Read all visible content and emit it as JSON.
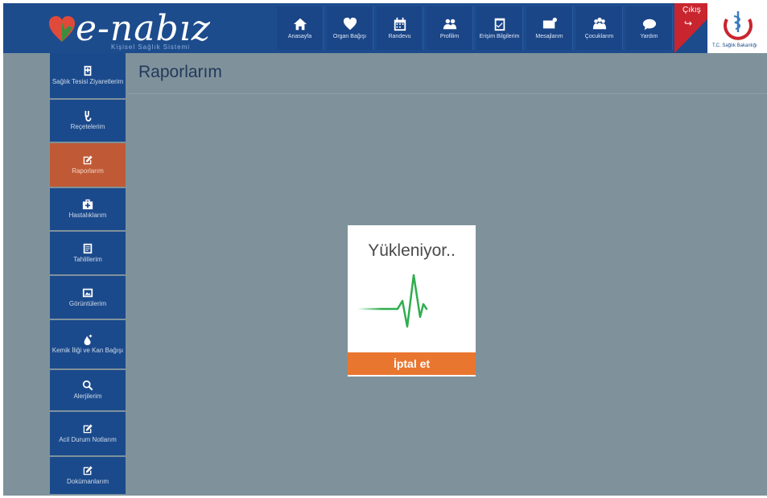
{
  "header": {
    "brand_prefix": "e-",
    "brand_name": "nabız",
    "tagline": "Kişisel Sağlık Sistemi",
    "nav": [
      {
        "label": "Anasayfa",
        "icon": "home-icon"
      },
      {
        "label": "Organ Bağışı",
        "icon": "heart-icon"
      },
      {
        "label": "Randevu",
        "icon": "calendar-icon"
      },
      {
        "label": "Profilim",
        "icon": "users-icon"
      },
      {
        "label": "Erişim Bilgilerim",
        "icon": "clipboard-icon"
      },
      {
        "label": "Mesajlarım",
        "icon": "envelope-icon"
      },
      {
        "label": "Çocuklarım",
        "icon": "family-icon"
      },
      {
        "label": "Yardım",
        "icon": "chat-bubble-icon"
      }
    ],
    "exit_label": "Çıkış",
    "ministry_label": "T.C. Sağlık Bakanlığı"
  },
  "sidebar": {
    "items": [
      {
        "label": "Sağlık Tesisi Ziyaretlerim",
        "icon": "hospital-building-icon",
        "active": false
      },
      {
        "label": "Reçetelerim",
        "icon": "pill-icon",
        "active": false
      },
      {
        "label": "Raporlarım",
        "icon": "edit-icon",
        "active": true
      },
      {
        "label": "Hastalıklarım",
        "icon": "medical-case-icon",
        "active": false
      },
      {
        "label": "Tahlillerim",
        "icon": "document-icon",
        "active": false
      },
      {
        "label": "Görüntülerim",
        "icon": "image-icon",
        "active": false
      },
      {
        "label": "Kemik İliği ve Kan Bağışı",
        "icon": "blood-drop-icon",
        "active": false
      },
      {
        "label": "Alerjilerim",
        "icon": "search-icon",
        "active": false
      },
      {
        "label": "Acil Durum Notlarım",
        "icon": "edit-icon",
        "active": false
      },
      {
        "label": "Dokümanlarım",
        "icon": "edit-icon",
        "active": false
      }
    ]
  },
  "main": {
    "page_title": "Raporlarım"
  },
  "modal": {
    "loading_text": "Yükleniyor..",
    "cancel_label": "İptal et"
  },
  "colors": {
    "header_bg": "#1d4c8d",
    "content_bg": "#7f929b",
    "active_item": "#c05a36",
    "cancel_button": "#e9762f",
    "pulse_line": "#2fae4e",
    "exit_red": "#c9252e"
  }
}
